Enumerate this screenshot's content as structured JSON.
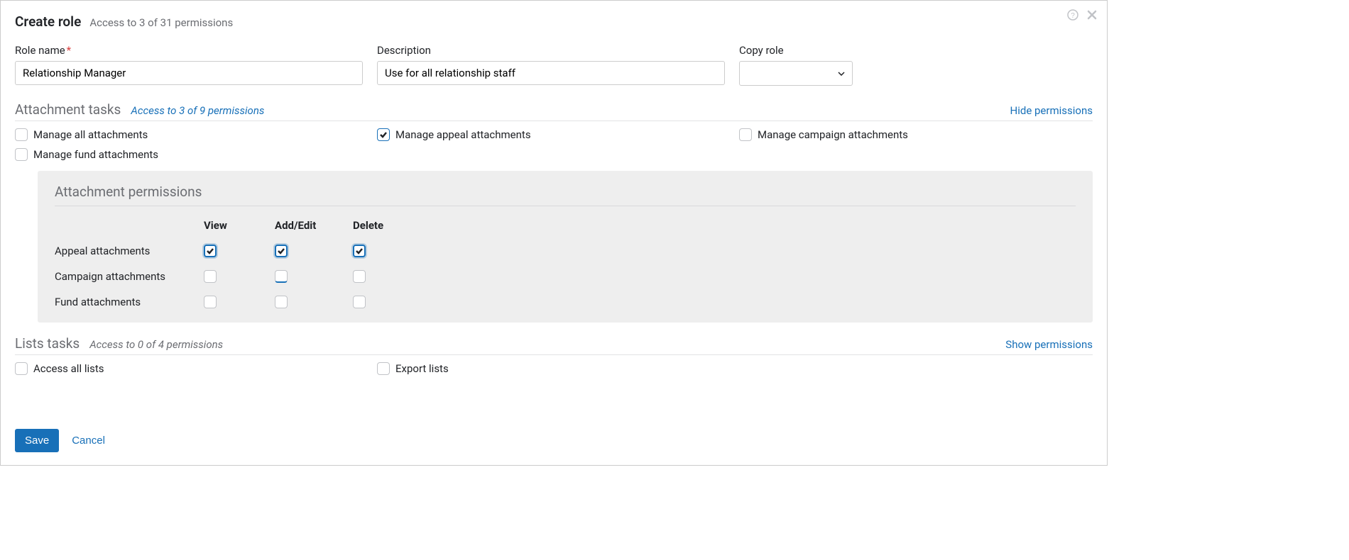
{
  "header": {
    "title": "Create role",
    "subtitle": "Access to 3 of 31 permissions"
  },
  "form": {
    "rolename_label": "Role name",
    "rolename_value": "Relationship Manager",
    "description_label": "Description",
    "description_value": "Use for all relationship staff",
    "copyrole_label": "Copy role"
  },
  "attachment_section": {
    "title": "Attachment tasks",
    "subtitle": "Access to 3 of 9 permissions",
    "toggle": "Hide permissions",
    "tasks": [
      {
        "label": "Manage all attachments",
        "checked": false
      },
      {
        "label": "Manage appeal attachments",
        "checked": true
      },
      {
        "label": "Manage campaign attachments",
        "checked": false
      },
      {
        "label": "Manage fund attachments",
        "checked": false
      }
    ],
    "panel": {
      "title": "Attachment permissions",
      "columns": [
        "View",
        "Add/Edit",
        "Delete"
      ],
      "rows": [
        {
          "label": "Appeal attachments",
          "values": [
            true,
            true,
            true
          ]
        },
        {
          "label": "Campaign attachments",
          "values": [
            false,
            false,
            false
          ]
        },
        {
          "label": "Fund attachments",
          "values": [
            false,
            false,
            false
          ]
        }
      ]
    }
  },
  "lists_section": {
    "title": "Lists tasks",
    "subtitle": "Access to 0 of 4 permissions",
    "toggle": "Show permissions",
    "tasks": [
      {
        "label": "Access all lists",
        "checked": false
      },
      {
        "label": "Export lists",
        "checked": false
      }
    ]
  },
  "footer": {
    "save": "Save",
    "cancel": "Cancel"
  }
}
